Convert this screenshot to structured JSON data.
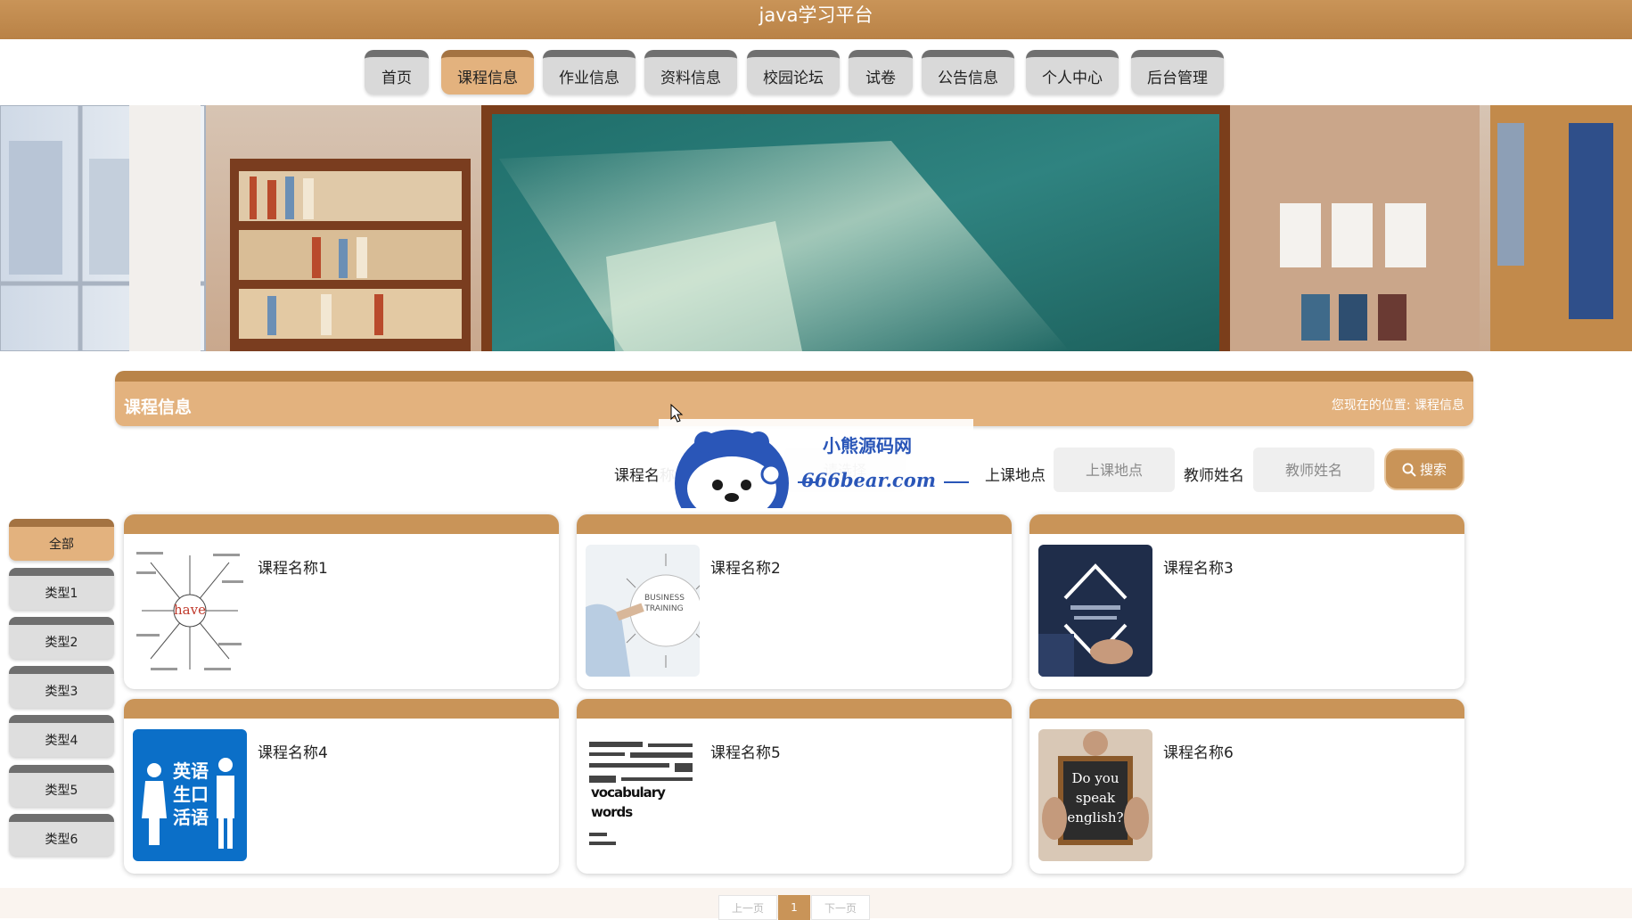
{
  "app": {
    "title": "java学习平台"
  },
  "nav": {
    "items": [
      {
        "label": "首页",
        "active": false
      },
      {
        "label": "课程信息",
        "active": true
      },
      {
        "label": "作业信息",
        "active": false
      },
      {
        "label": "资料信息",
        "active": false
      },
      {
        "label": "校园论坛",
        "active": false
      },
      {
        "label": "试卷",
        "active": false
      },
      {
        "label": "公告信息",
        "active": false
      },
      {
        "label": "个人中心",
        "active": false
      },
      {
        "label": "后台管理",
        "active": false
      }
    ]
  },
  "section": {
    "title": "课程信息",
    "location_prefix": "您现在的位置:",
    "location_value": "课程信息"
  },
  "search": {
    "course_name_label": "课程名称",
    "type_placeholder": "请选择",
    "location_label": "上课地点",
    "location_placeholder": "上课地点",
    "teacher_label": "教师姓名",
    "teacher_placeholder": "教师姓名",
    "button_label": "搜索"
  },
  "watermark": {
    "line1": "小熊源码网",
    "line2": "666bear.com"
  },
  "categories": [
    "全部",
    "类型1",
    "类型2",
    "类型3",
    "类型4",
    "类型5",
    "类型6"
  ],
  "courses": [
    {
      "name": "课程名称1",
      "image_text": "have"
    },
    {
      "name": "课程名称2",
      "image_text": "BUSINESS TRAINING"
    },
    {
      "name": "课程名称3",
      "image_text": ""
    },
    {
      "name": "课程名称4",
      "image_text": "英语 生口 活语"
    },
    {
      "name": "课程名称5",
      "image_text": "vocabulary words"
    },
    {
      "name": "课程名称6",
      "image_text": "Do you speak english?"
    }
  ],
  "pagination": {
    "prev": "上一页",
    "current": "1",
    "next": "下一页"
  },
  "colors": {
    "accent": "#c99458",
    "accent_light": "#e3b27e",
    "tab_border": "#6f6f6f"
  }
}
